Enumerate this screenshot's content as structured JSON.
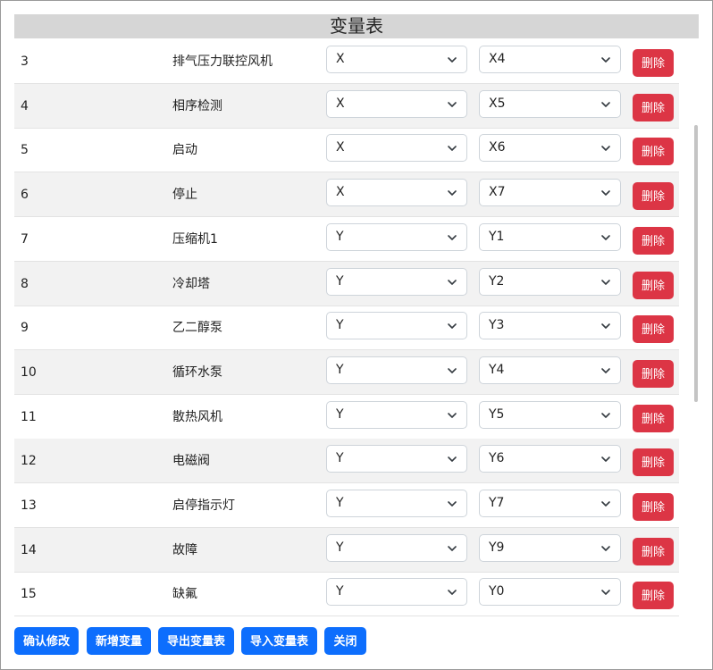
{
  "title": "变量表",
  "delete_label": "删除",
  "rows": [
    {
      "id": "3",
      "name": "排气压力联控风机",
      "type": "X",
      "addr": "X4"
    },
    {
      "id": "4",
      "name": "相序检测",
      "type": "X",
      "addr": "X5"
    },
    {
      "id": "5",
      "name": "启动",
      "type": "X",
      "addr": "X6"
    },
    {
      "id": "6",
      "name": "停止",
      "type": "X",
      "addr": "X7"
    },
    {
      "id": "7",
      "name": "压缩机1",
      "type": "Y",
      "addr": "Y1"
    },
    {
      "id": "8",
      "name": "冷却塔",
      "type": "Y",
      "addr": "Y2"
    },
    {
      "id": "9",
      "name": "乙二醇泵",
      "type": "Y",
      "addr": "Y3"
    },
    {
      "id": "10",
      "name": "循环水泵",
      "type": "Y",
      "addr": "Y4"
    },
    {
      "id": "11",
      "name": "散热风机",
      "type": "Y",
      "addr": "Y5"
    },
    {
      "id": "12",
      "name": "电磁阀",
      "type": "Y",
      "addr": "Y6"
    },
    {
      "id": "13",
      "name": "启停指示灯",
      "type": "Y",
      "addr": "Y7"
    },
    {
      "id": "14",
      "name": "故障",
      "type": "Y",
      "addr": "Y9"
    },
    {
      "id": "15",
      "name": "缺氟",
      "type": "Y",
      "addr": "Y0"
    }
  ],
  "footer": {
    "confirm": "确认修改",
    "add": "新增变量",
    "export": "导出变量表",
    "import": "导入变量表",
    "close": "关闭"
  },
  "colors": {
    "primary": "#0d6efd",
    "danger": "#dc3545",
    "header_bg": "#d6d6d6",
    "row_alt": "#f2f2f2"
  },
  "icons": {
    "dropdown": "chevron-down-icon"
  }
}
